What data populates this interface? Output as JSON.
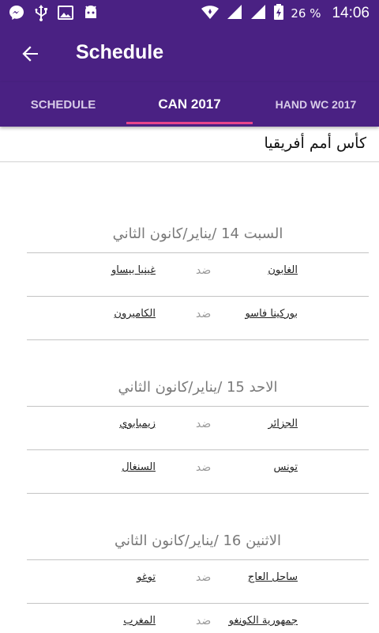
{
  "status_bar": {
    "battery_percent": "26 %",
    "time": "14:06",
    "icons": [
      "messenger-icon",
      "usb-icon",
      "image-icon",
      "android-icon",
      "wifi-icon",
      "signal-icon",
      "signal-icon",
      "battery-charging-icon"
    ]
  },
  "app_bar": {
    "title": "Schedule",
    "back_icon": "arrow-back-icon"
  },
  "tabs": [
    {
      "label": "SCHEDULE",
      "selected": false
    },
    {
      "label": "CAN 2017",
      "selected": true
    },
    {
      "label": "HAND WC 2017",
      "selected": false
    }
  ],
  "colors": {
    "primary": "#4a2183",
    "indicator": "#e8458b"
  },
  "competition_title": "كأس أمم أفريقيا",
  "days": [
    {
      "header": "السبت 14 /يناير/كانون الثاني",
      "matches": [
        {
          "home": "الغابون",
          "vs": "ضد",
          "away": "غينيا بيساو"
        },
        {
          "home": "بوركينا فاسو",
          "vs": "ضد",
          "away": "الكاميرون"
        }
      ]
    },
    {
      "header": "الاحد 15 /يناير/كانون الثاني",
      "matches": [
        {
          "home": "الجزائر",
          "vs": "ضد",
          "away": "زيمبابوي"
        },
        {
          "home": "تونس",
          "vs": "ضد",
          "away": "السنغال"
        }
      ]
    },
    {
      "header": "الاثنين 16 /يناير/كانون الثاني",
      "matches": [
        {
          "home": "ساحل العاج",
          "vs": "ضد",
          "away": "توغو"
        },
        {
          "home": "جمهورية الكونغو",
          "vs": "ضد",
          "away": "المغرب"
        }
      ]
    }
  ]
}
